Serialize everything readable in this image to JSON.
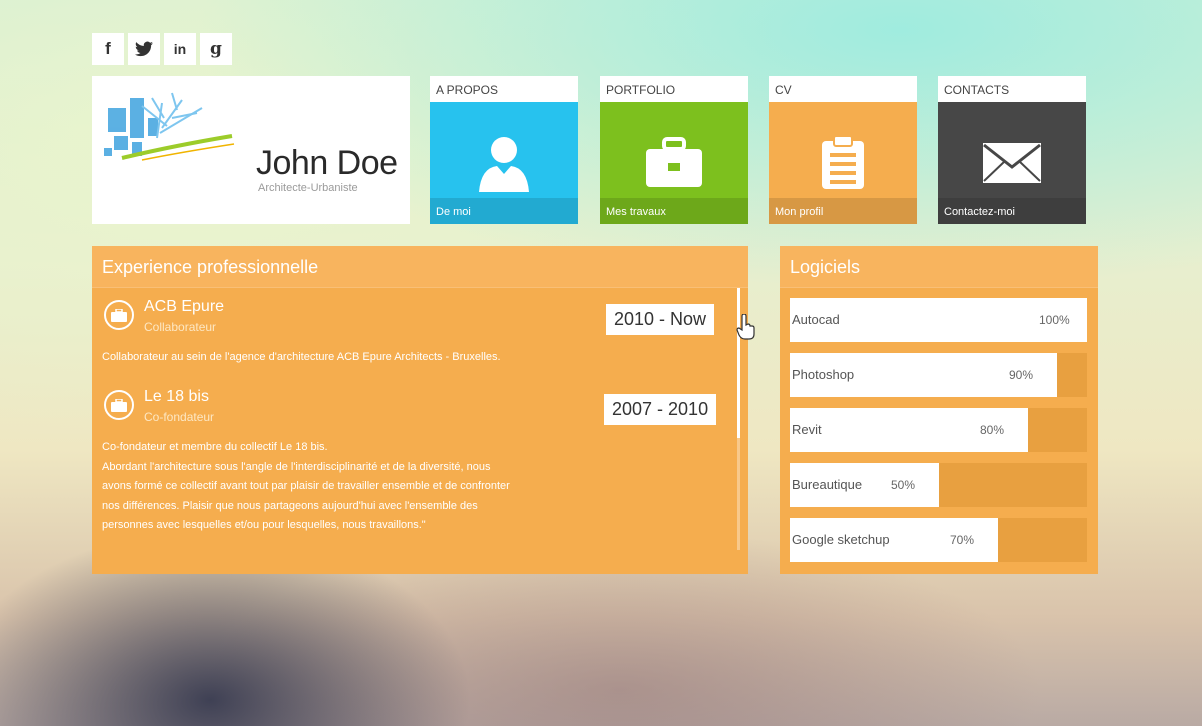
{
  "social": [
    {
      "icon": "facebook-icon",
      "glyph": "f"
    },
    {
      "icon": "twitter-icon",
      "glyph": "t"
    },
    {
      "icon": "linkedin-icon",
      "glyph": "in"
    },
    {
      "icon": "google-plus-icon",
      "glyph": "g"
    }
  ],
  "brand": {
    "name": "John Doe",
    "role": "Architecte-Urbaniste"
  },
  "tiles": [
    {
      "label": "A PROPOS",
      "sub": "De moi",
      "color": "#27c2ee",
      "icon": "user-icon"
    },
    {
      "label": "PORTFOLIO",
      "sub": "Mes travaux",
      "color": "#7dc01e",
      "icon": "briefcase-icon"
    },
    {
      "label": "CV",
      "sub": "Mon profil",
      "color": "#f5ad4e",
      "icon": "clipboard-icon"
    },
    {
      "label": "CONTACTS",
      "sub": "Contactez-moi",
      "color": "#474747",
      "icon": "envelope-icon"
    }
  ],
  "experience": {
    "title": "Experience professionnelle",
    "jobs": [
      {
        "company": "ACB Epure",
        "role": "Collaborateur",
        "dates": "2010 - Now",
        "desc": [
          "Collaborateur au sein de l'agence d'architecture ACB Epure Architects - Bruxelles."
        ]
      },
      {
        "company": "Le 18 bis",
        "role": "Co-fondateur",
        "dates": "2007 - 2010",
        "desc": [
          "Co-fondateur et membre du collectif Le 18 bis.",
          "Abordant l'architecture sous l'angle de l'interdisciplinarité et de la diversité, nous",
          "avons formé ce collectif avant tout par plaisir de travailler ensemble et de confronter",
          "nos différences. Plaisir que nous partageons aujourd'hui avec l'ensemble des",
          "personnes avec lesquelles et/ou pour lesquelles, nous travaillons.\""
        ]
      }
    ]
  },
  "software": {
    "title": "Logiciels",
    "skills": [
      {
        "name": "Autocad",
        "percent": "100%",
        "level": 1.0
      },
      {
        "name": "Photoshop",
        "percent": "90%",
        "level": 0.9
      },
      {
        "name": "Revit",
        "percent": "80%",
        "level": 0.8
      },
      {
        "name": "Bureautique",
        "percent": "50%",
        "level": 0.5
      },
      {
        "name": "Google sketchup",
        "percent": "70%",
        "level": 0.7
      }
    ]
  }
}
